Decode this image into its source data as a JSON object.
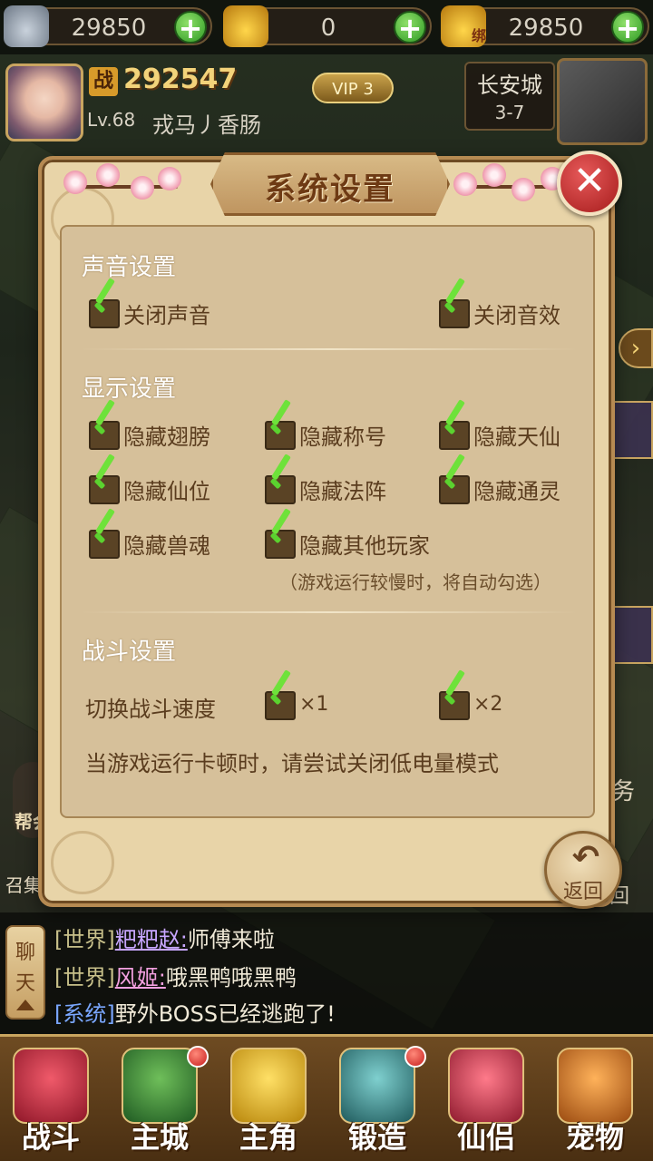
{
  "currency": {
    "silver": "29850",
    "gold": "0",
    "bound_gold": "29850",
    "bound_tag": "绑"
  },
  "player": {
    "power_icon": "战",
    "power": "292547",
    "vip": "VIP 3",
    "level": "Lv.68",
    "name": "戎马丿香肠"
  },
  "location": {
    "map": "长安城",
    "coord": "3-7"
  },
  "dialog": {
    "title": "系统设置",
    "close_glyph": "✕",
    "sound": {
      "title": "声音设置",
      "options": [
        "关闭声音",
        "关闭音效"
      ]
    },
    "display": {
      "title": "显示设置",
      "options": [
        "隐藏翅膀",
        "隐藏称号",
        "隐藏天仙",
        "隐藏仙位",
        "隐藏法阵",
        "隐藏通灵",
        "隐藏兽魂",
        "隐藏其他玩家"
      ],
      "hint": "（游戏运行较慢时，将自动勾选）"
    },
    "battle": {
      "title": "战斗设置",
      "speed_label": "切换战斗速度",
      "speed_options": [
        "×1",
        "×2"
      ],
      "tip": "当游戏运行卡顿时，请尝试关闭低电量模式"
    },
    "back_label": "返回"
  },
  "background": {
    "guild_label": "帮会",
    "summon_label": "召集",
    "task_label": "务",
    "back_edge_label": "回"
  },
  "chat": {
    "tab": [
      "聊",
      "天"
    ],
    "messages": [
      {
        "channel": "[世界]",
        "sender": "粑粑赵:",
        "text": "师傅来啦"
      },
      {
        "channel": "[世界]",
        "sender": "风姬:",
        "text": "哦黑鸭哦黑鸭"
      },
      {
        "channel": "[系统]",
        "sender": "",
        "text": "野外BOSS已经逃跑了!"
      }
    ]
  },
  "nav": {
    "items": [
      {
        "label": "战斗",
        "icon": "battle-icon",
        "color": "#d8344a"
      },
      {
        "label": "主城",
        "icon": "city-icon",
        "color": "#3f8a3a"
      },
      {
        "label": "主角",
        "icon": "hero-icon",
        "color": "#e9b62b"
      },
      {
        "label": "锻造",
        "icon": "forge-icon",
        "color": "#3c8a8c"
      },
      {
        "label": "仙侣",
        "icon": "partner-icon",
        "color": "#d0405a"
      },
      {
        "label": "宠物",
        "icon": "pet-icon",
        "color": "#d9842a"
      }
    ]
  }
}
